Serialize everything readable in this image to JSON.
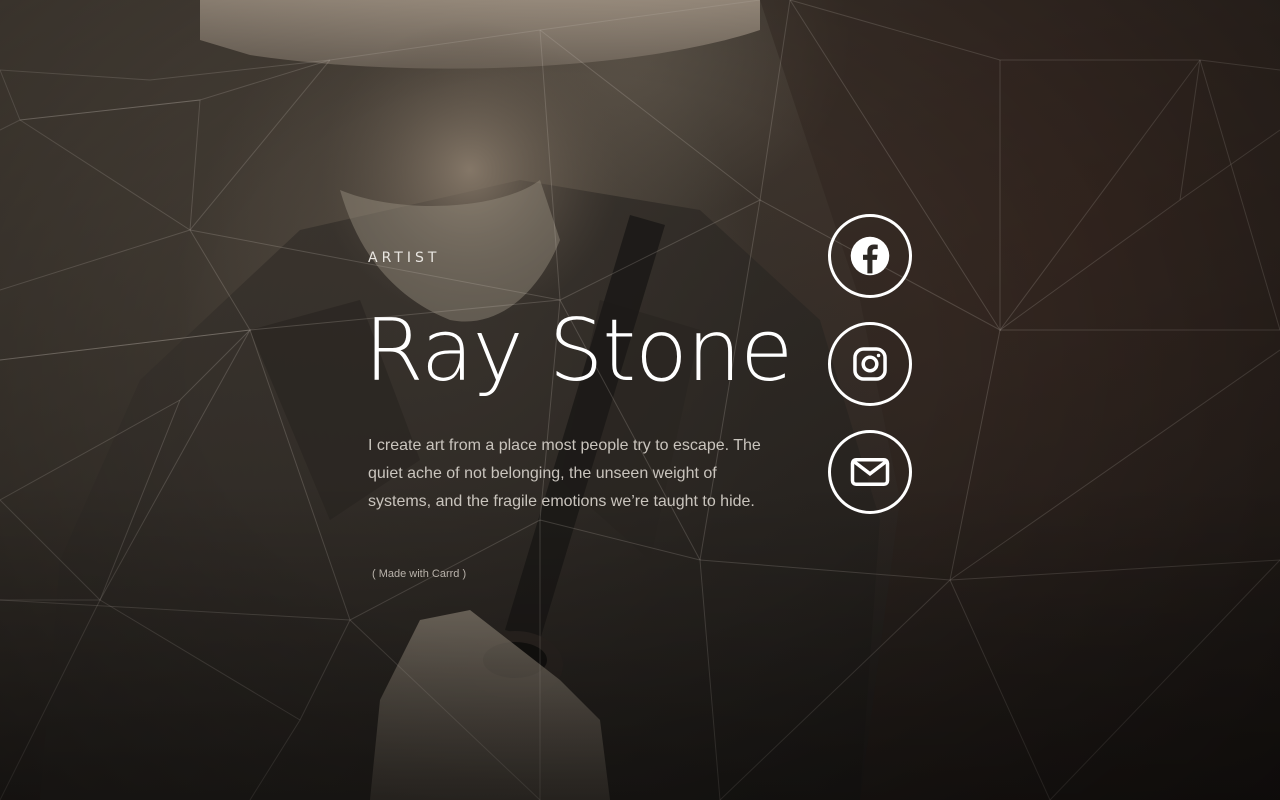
{
  "page": {
    "kicker": "ARTIST",
    "title": "Ray Stone",
    "bio": "I create art from a place most people try to escape. The quiet ache of not belonging, the unseen weight of systems, and the fragile emotions we’re taught to hide.",
    "credit": "( Made with Carrd )"
  },
  "socials": [
    {
      "icon": "facebook-icon"
    },
    {
      "icon": "instagram-icon"
    },
    {
      "icon": "envelope-icon"
    }
  ],
  "colors": {
    "text": "#ffffff",
    "muted": "#c9c4bd",
    "background": "#2b2622"
  }
}
